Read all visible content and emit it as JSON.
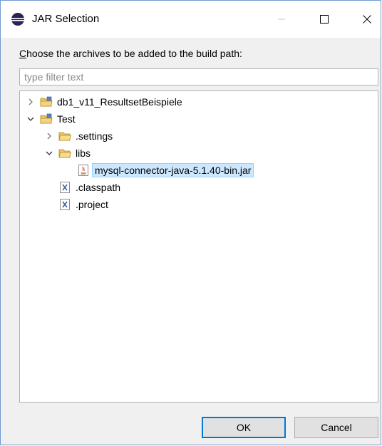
{
  "window": {
    "title": "JAR Selection",
    "controls": {
      "minimize": "minimize-icon",
      "maximize": "maximize-icon",
      "close": "close-icon"
    }
  },
  "instruction": {
    "mnemonic": "C",
    "rest": "hoose the archives to be added to the build path:"
  },
  "filter": {
    "value": "",
    "placeholder": "type filter text"
  },
  "tree": {
    "items": [
      {
        "label": "db1_v11_ResultsetBeispiele",
        "icon": "project-folder-icon",
        "expanded": false
      },
      {
        "label": "Test",
        "icon": "project-folder-icon",
        "expanded": true
      },
      {
        "label": ".settings",
        "icon": "folder-icon",
        "expanded": false
      },
      {
        "label": "libs",
        "icon": "folder-icon",
        "expanded": true
      },
      {
        "label": "mysql-connector-java-5.1.40-bin.jar",
        "icon": "jar-file-icon",
        "selected": true
      },
      {
        "label": ".classpath",
        "icon": "xml-file-icon"
      },
      {
        "label": ".project",
        "icon": "xml-file-icon"
      }
    ]
  },
  "buttons": {
    "ok": "OK",
    "cancel": "Cancel"
  },
  "colors": {
    "accent": "#0078d7",
    "selection": "#cce8ff",
    "window_border": "#6f9bd4"
  }
}
